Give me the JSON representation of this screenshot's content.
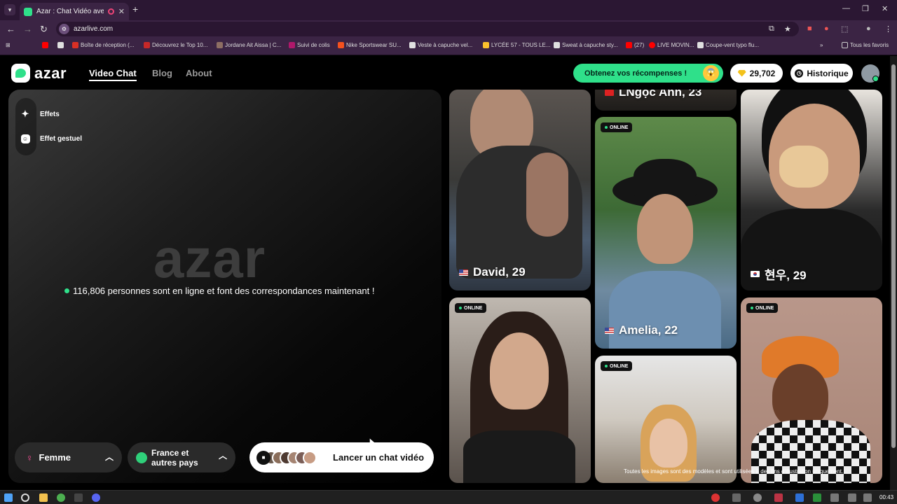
{
  "browser": {
    "tab_title": "Azar : Chat Vidéo avec de n",
    "new_tab": "+",
    "url": "azarlive.com",
    "bookmarks": [
      {
        "label": "Boîte de réception (...",
        "color": "#d93025"
      },
      {
        "label": "Découvrez le Top 10...",
        "color": "#c62828"
      },
      {
        "label": "Jordane Ait Aissa | C...",
        "color": "#8d6e63"
      },
      {
        "label": "Suivi de colis",
        "color": "#b0186b"
      },
      {
        "label": "Nike Sportswear SU...",
        "color": "#f4511e"
      },
      {
        "label": "Veste à capuche vel...",
        "color": "#e0e0e0"
      },
      {
        "label": "LYCÉE 57 - TOUS LE...",
        "color": "#fbc02d"
      },
      {
        "label": "Sweat à capuche sty...",
        "color": "#e0e0e0"
      },
      {
        "label": "(27)",
        "color": "#ff0000"
      },
      {
        "label": "LIVE MOVIN...",
        "color": "#ff0000"
      },
      {
        "label": "Coupe-vent typo flu...",
        "color": "#e0e0e0"
      }
    ],
    "all_bookmarks": "Tous les favoris"
  },
  "site": {
    "logo": "azar",
    "nav": {
      "video_chat": "Video Chat",
      "blog": "Blog",
      "about": "About"
    },
    "rewards_label": "Obtenez vos récompenses !",
    "gems": "29,702",
    "history_label": "Historique",
    "effects": {
      "effects_label": "Effets",
      "gesture_label": "Effet gestuel"
    },
    "stage_logo": "azar",
    "online_text": "116,806 personnes sont en ligne et font des correspondances maintenant !",
    "gender_label": "Femme",
    "country_label_1": "France et",
    "country_label_2": "autres pays",
    "launch_label": "Lancer un chat vidéo",
    "disclaimer": "Toutes les images sont des modèles et sont utilisées à des fins d'illustration uniquement.",
    "online_badge": "ONLINE",
    "profiles": {
      "david": "David, 29",
      "lngoc": "LNgọc Anh, 23",
      "hyunwoo": "현우, 29",
      "amelia": "Amelia, 22"
    }
  },
  "taskbar": {
    "time": "00:43"
  },
  "colors": {
    "accent": "#2fe08a",
    "browser_frame": "#3b2444"
  }
}
